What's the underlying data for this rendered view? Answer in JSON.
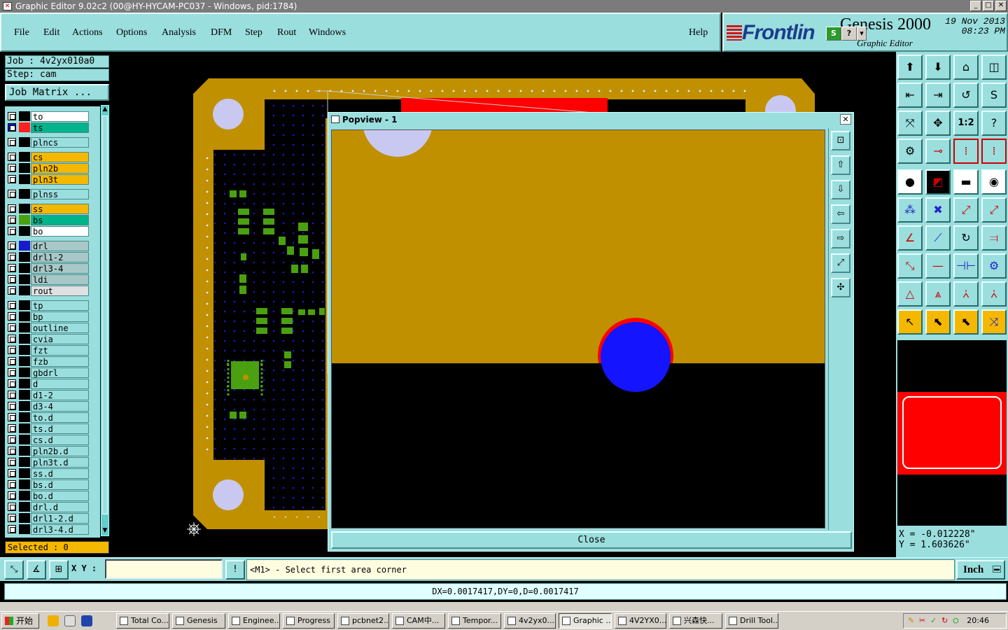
{
  "window": {
    "title": "Graphic Editor 9.02c2 (00@HY-HYCAM-PC037 - Windows, pid:1784)"
  },
  "menu": [
    {
      "label": "File"
    },
    {
      "label": "Edit"
    },
    {
      "label": "Actions"
    },
    {
      "label": "Options"
    },
    {
      "label": "Analysis"
    },
    {
      "label": "DFM"
    },
    {
      "label": "Step"
    },
    {
      "label": "Rout"
    },
    {
      "label": "Windows"
    },
    {
      "label": "Help"
    }
  ],
  "brand": {
    "logo": "Frontlin",
    "product": "Genesis 2000",
    "subtitle": "Graphic Editor",
    "date": "19 Nov 2013",
    "time": "08:23 PM"
  },
  "job": {
    "job_label": "Job : 4v2yx010a0",
    "step_label": "Step: cam",
    "matrix_button": "Job Matrix ..."
  },
  "layers": [
    {
      "name": "to",
      "color": "#ffffff",
      "swatch": "#000000",
      "active": false
    },
    {
      "name": "ts",
      "color": "#00b38a",
      "swatch": "#ff2020",
      "active": true
    },
    {
      "name": "plncs",
      "color": "#9bdede",
      "swatch": "#000000",
      "active": false
    },
    {
      "name": "cs",
      "color": "#f5b800",
      "swatch": "#000000",
      "active": false
    },
    {
      "name": "pln2b",
      "color": "#f5b800",
      "swatch": "#000000",
      "active": false
    },
    {
      "name": "pln3t",
      "color": "#f5b800",
      "swatch": "#000000",
      "active": false
    },
    {
      "name": "plnss",
      "color": "#9bdede",
      "swatch": "#000000",
      "active": false
    },
    {
      "name": "ss",
      "color": "#f5b800",
      "swatch": "#000000",
      "active": false
    },
    {
      "name": "bs",
      "color": "#00b38a",
      "swatch": "#4aa010",
      "active": false
    },
    {
      "name": "bo",
      "color": "#ffffff",
      "swatch": "#000000",
      "active": false
    },
    {
      "name": "drl",
      "color": "#a8c8c8",
      "swatch": "#1a1acc",
      "active": false
    },
    {
      "name": "drl1-2",
      "color": "#a8c8c8",
      "swatch": "#000000",
      "active": false
    },
    {
      "name": "drl3-4",
      "color": "#a8c8c8",
      "swatch": "#000000",
      "active": false
    },
    {
      "name": "ldi",
      "color": "#a8c8c8",
      "swatch": "#000000",
      "active": false
    },
    {
      "name": "rout",
      "color": "#e0e0e0",
      "swatch": "#000000",
      "active": false
    },
    {
      "name": "tp",
      "color": "#9bdede",
      "swatch": "#000000",
      "active": false
    },
    {
      "name": "bp",
      "color": "#9bdede",
      "swatch": "#000000",
      "active": false
    },
    {
      "name": "outline",
      "color": "#9bdede",
      "swatch": "#000000",
      "active": false
    },
    {
      "name": "cvia",
      "color": "#9bdede",
      "swatch": "#000000",
      "active": false
    },
    {
      "name": "fzt",
      "color": "#9bdede",
      "swatch": "#000000",
      "active": false
    },
    {
      "name": "fzb",
      "color": "#9bdede",
      "swatch": "#000000",
      "active": false
    },
    {
      "name": "gbdrl",
      "color": "#9bdede",
      "swatch": "#000000",
      "active": false
    },
    {
      "name": "d",
      "color": "#9bdede",
      "swatch": "#000000",
      "active": false
    },
    {
      "name": "d1-2",
      "color": "#9bdede",
      "swatch": "#000000",
      "active": false
    },
    {
      "name": "d3-4",
      "color": "#9bdede",
      "swatch": "#000000",
      "active": false
    },
    {
      "name": "to.d",
      "color": "#9bdede",
      "swatch": "#000000",
      "active": false
    },
    {
      "name": "ts.d",
      "color": "#9bdede",
      "swatch": "#000000",
      "active": false
    },
    {
      "name": "cs.d",
      "color": "#9bdede",
      "swatch": "#000000",
      "active": false
    },
    {
      "name": "pln2b.d",
      "color": "#9bdede",
      "swatch": "#000000",
      "active": false
    },
    {
      "name": "pln3t.d",
      "color": "#9bdede",
      "swatch": "#000000",
      "active": false
    },
    {
      "name": "ss.d",
      "color": "#9bdede",
      "swatch": "#000000",
      "active": false
    },
    {
      "name": "bs.d",
      "color": "#9bdede",
      "swatch": "#000000",
      "active": false
    },
    {
      "name": "bo.d",
      "color": "#9bdede",
      "swatch": "#000000",
      "active": false
    },
    {
      "name": "drl.d",
      "color": "#9bdede",
      "swatch": "#000000",
      "active": false
    },
    {
      "name": "drl1-2.d",
      "color": "#9bdede",
      "swatch": "#000000",
      "active": false
    },
    {
      "name": "drl3-4.d",
      "color": "#9bdede",
      "swatch": "#000000",
      "active": false
    }
  ],
  "selected_label": "Selected : 0",
  "popview": {
    "title": "Popview - 1",
    "close_label": "Close"
  },
  "coords": {
    "x": "X = -0.012228\"",
    "y": "Y =  1.603626\""
  },
  "bottom": {
    "xy_label": "X Y :",
    "xy_value": "",
    "prompt": "<M1> - Select first area corner",
    "unit": "Inch"
  },
  "status": {
    "measure": "DX=0.0017417,DY=0,D=0.0017417"
  },
  "colors": {
    "copper": "#c09000",
    "panel": "#9bdede",
    "hole": "#1414ff",
    "pad": "#ff0000",
    "smd": "#4aa010",
    "via": "#1a1acc",
    "tooling": "#c8c8f0"
  },
  "taskbar": {
    "start": "开始",
    "tasks": [
      {
        "label": "Total Co..."
      },
      {
        "label": "Genesis"
      },
      {
        "label": "Enginee..."
      },
      {
        "label": "Progress"
      },
      {
        "label": "pcbnet2..."
      },
      {
        "label": "CAM中..."
      },
      {
        "label": "Tempor..."
      },
      {
        "label": "4v2yx0..."
      },
      {
        "label": "Graphic ..."
      },
      {
        "label": "4V2YX0..."
      },
      {
        "label": "兴森快..."
      },
      {
        "label": "Drill Tool..."
      }
    ],
    "clock": "20:46"
  }
}
